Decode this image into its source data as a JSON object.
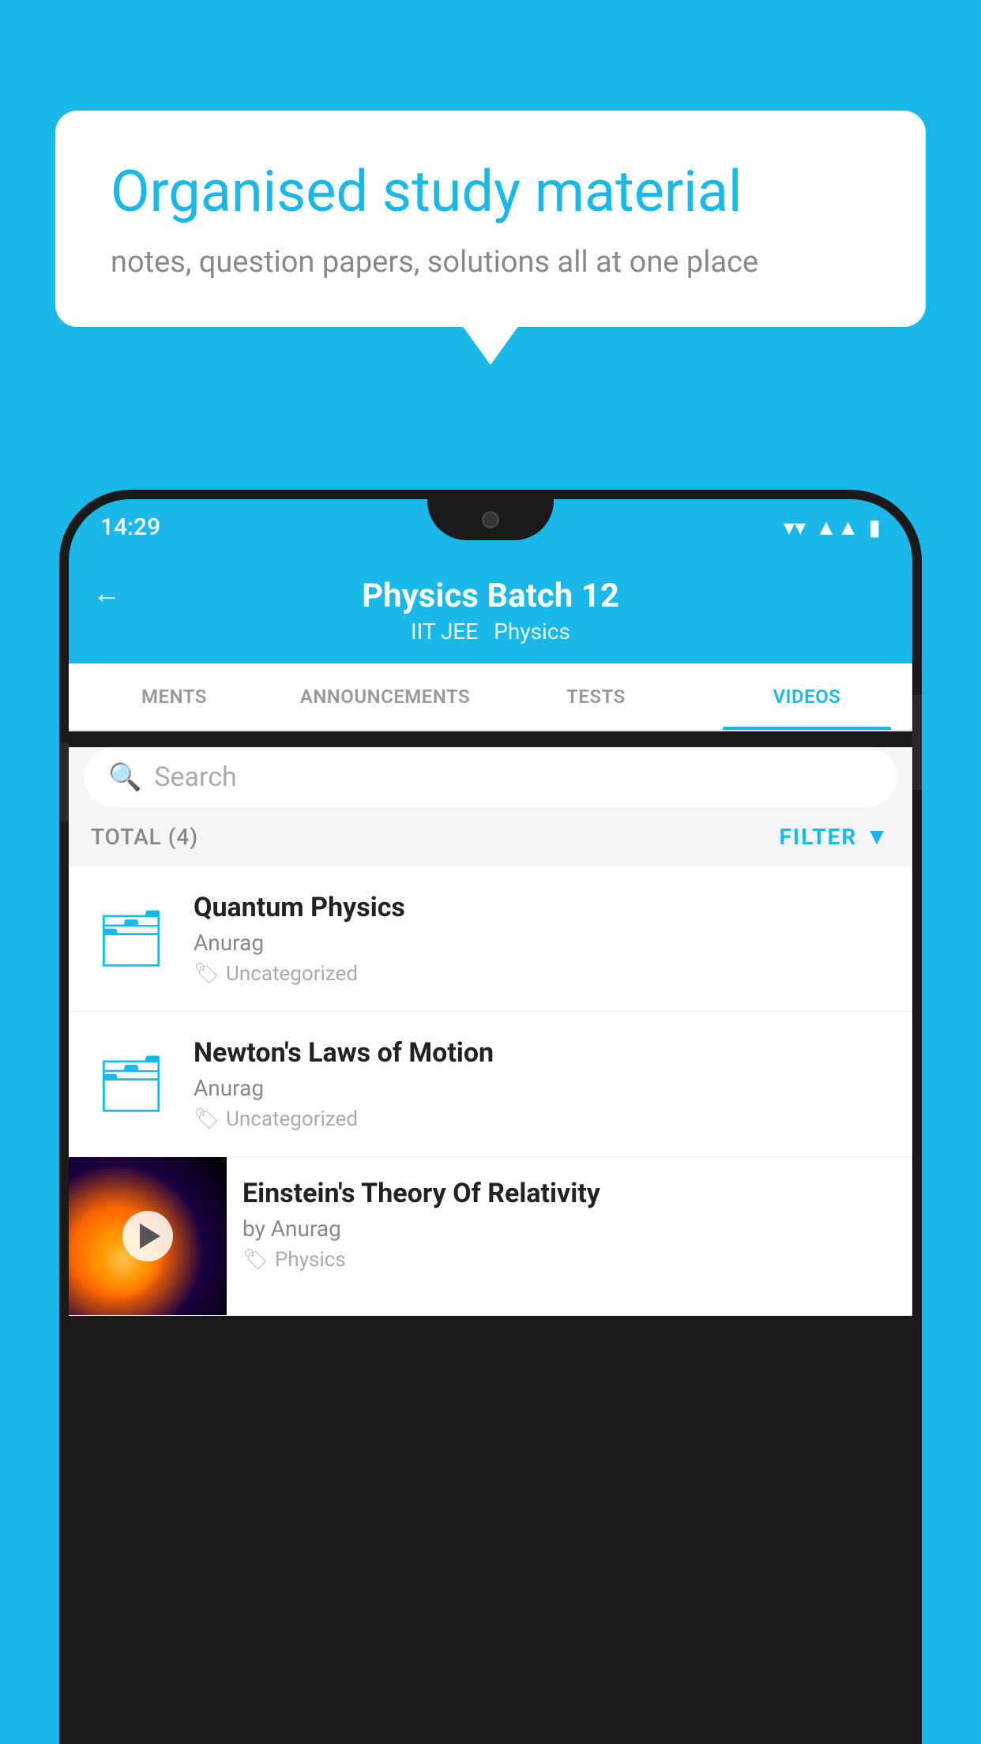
{
  "background_color": "#1ab8e8",
  "bubble": {
    "title": "Organised study material",
    "subtitle": "notes, question papers, solutions all at one place"
  },
  "phone": {
    "status_bar": {
      "time": "14:29",
      "wifi": "▾",
      "signal": "▲",
      "battery": "▮"
    },
    "header": {
      "back_label": "←",
      "title": "Physics Batch 12",
      "subtitle_left": "IIT JEE",
      "subtitle_right": "Physics"
    },
    "tabs": [
      {
        "label": "MENTS",
        "active": false
      },
      {
        "label": "ANNOUNCEMENTS",
        "active": false
      },
      {
        "label": "TESTS",
        "active": false
      },
      {
        "label": "VIDEOS",
        "active": true
      }
    ],
    "search": {
      "placeholder": "Search"
    },
    "filter": {
      "total_label": "TOTAL (4)",
      "filter_label": "FILTER"
    },
    "videos": [
      {
        "id": 1,
        "title": "Quantum Physics",
        "author": "Anurag",
        "tag": "Uncategorized",
        "type": "folder"
      },
      {
        "id": 2,
        "title": "Newton's Laws of Motion",
        "author": "Anurag",
        "tag": "Uncategorized",
        "type": "folder"
      },
      {
        "id": 3,
        "title": "Einstein's Theory Of Relativity",
        "author": "by Anurag",
        "tag": "Physics",
        "type": "video"
      }
    ]
  }
}
